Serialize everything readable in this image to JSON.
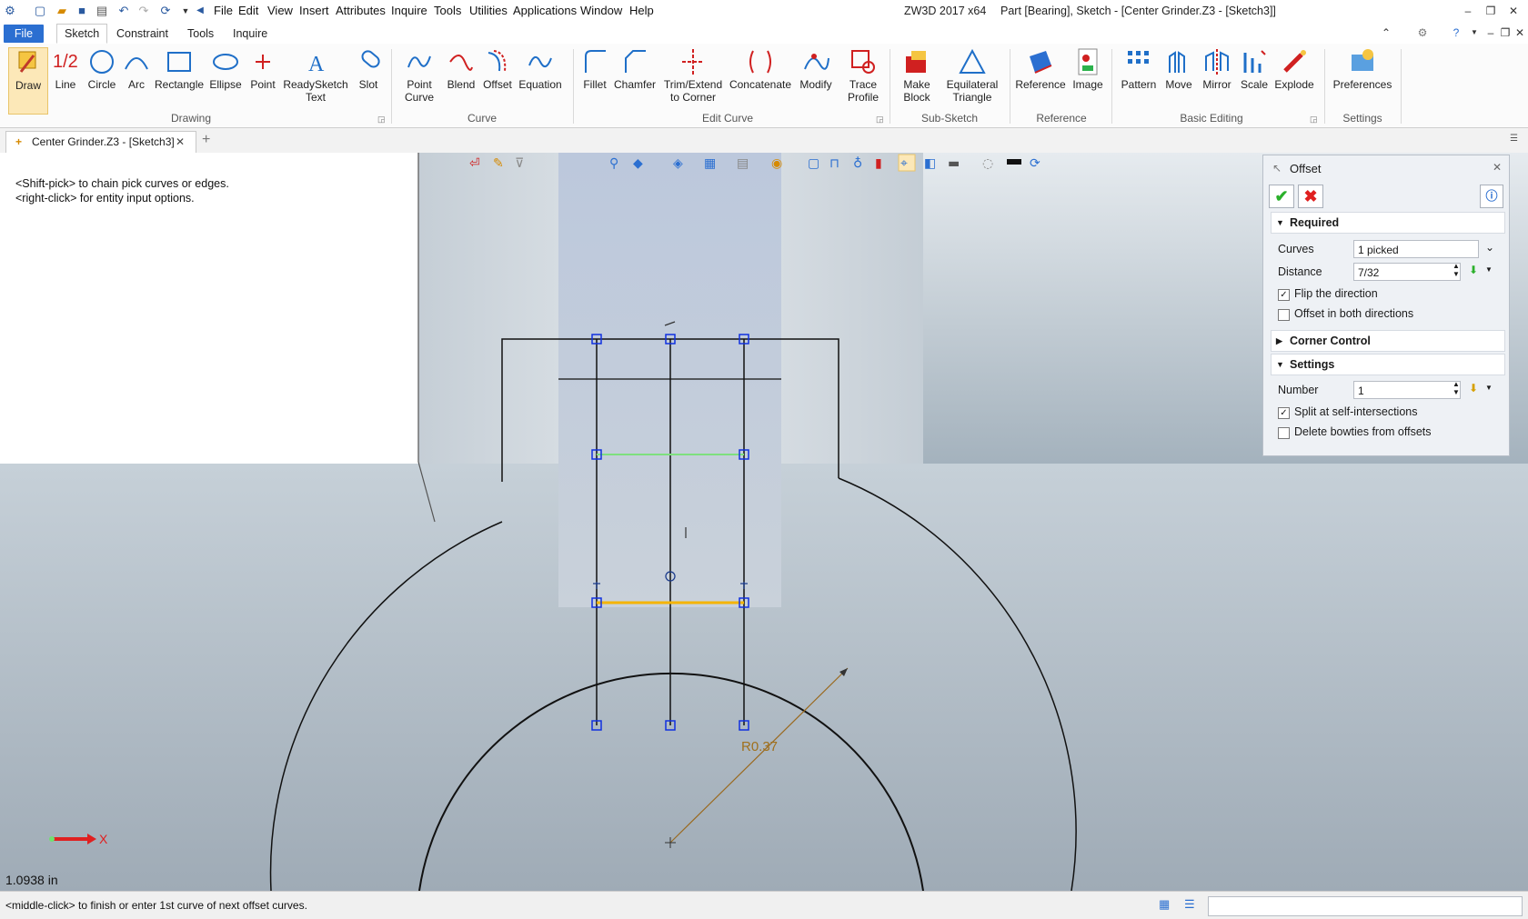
{
  "menubar": [
    "File",
    "Edit",
    "View",
    "Insert",
    "Attributes",
    "Inquire",
    "Tools",
    "Utilities",
    "Applications",
    "Window",
    "Help"
  ],
  "app_title": "ZW3D 2017  x64",
  "document_title": "Part [Bearing],  Sketch - [Center Grinder.Z3 - [Sketch3]]",
  "ribbon_tabs": [
    "File",
    "Sketch",
    "Constraint",
    "Tools",
    "Inquire"
  ],
  "ribbon": {
    "drawing": [
      "Draw",
      "Line",
      "Circle",
      "Arc",
      "Rectangle",
      "Ellipse",
      "Point",
      "ReadySketch\nText",
      "Slot"
    ],
    "curve": [
      "Point\nCurve",
      "Blend",
      "Offset",
      "Equation"
    ],
    "edit_curve": [
      "Fillet",
      "Chamfer",
      "Trim/Extend\nto Corner",
      "Concatenate",
      "Modify",
      "Trace\nProfile"
    ],
    "sub_sketch": [
      "Make\nBlock",
      "Equilateral\nTriangle"
    ],
    "reference": [
      "Reference",
      "Image"
    ],
    "basic_editing": [
      "Pattern",
      "Move",
      "Mirror",
      "Scale",
      "Explode"
    ],
    "settings": [
      "Preferences"
    ],
    "group_labels": [
      "Drawing",
      "Curve",
      "Edit Curve",
      "Sub-Sketch",
      "Reference",
      "Basic Editing",
      "Settings"
    ]
  },
  "doc_tab": "Center Grinder.Z3 - [Sketch3]",
  "hint_text": "<Shift-pick> to chain pick curves or edges.\n<right-click> for entity input options.",
  "unit_readout": "1.0938 in",
  "axis_label": "X",
  "dimension_label": "R0.37",
  "offset_panel": {
    "title": "Offset",
    "required_label": "Required",
    "curves_label": "Curves",
    "curves_value": "1 picked",
    "distance_label": "Distance",
    "distance_value": "7/32",
    "flip_label": "Flip the direction",
    "flip_checked": "✓",
    "both_label": "Offset in both directions",
    "corner_label": "Corner Control",
    "settings_label": "Settings",
    "number_label": "Number",
    "number_value": "1",
    "split_label": "Split at self-intersections",
    "split_checked": "✓",
    "bowties_label": "Delete bowties from offsets"
  },
  "status_text": "<middle-click> to finish or enter 1st curve of next offset curves."
}
